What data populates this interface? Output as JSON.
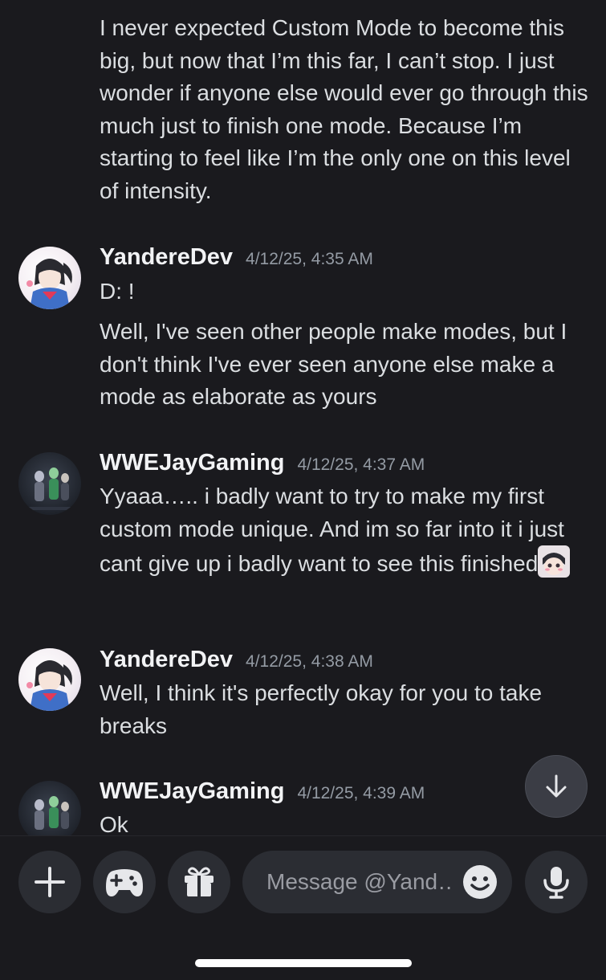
{
  "messages": [
    {
      "continuation_text": "I never expected Custom Mode to become this big, but now that I’m this far, I can’t stop. I just wonder if anyone else would ever go through this much just to finish one mode. Because I’m starting to feel like I’m the only one on this level of intensity."
    },
    {
      "author": "YandereDev",
      "timestamp": "4/12/25, 4:35 AM",
      "lines": [
        "D: !",
        "Well, I've seen other people make modes, but I don't think I've ever seen anyone else make a mode as elaborate as yours"
      ]
    },
    {
      "author": "WWEJayGaming",
      "timestamp": "4/12/25, 4:37 AM",
      "lines": [
        "Yyaaa….. i badly want to try to make my first custom mode unique. And im so far into it i just cant give up i badly want to see this finished"
      ]
    },
    {
      "author": "YandereDev",
      "timestamp": "4/12/25, 4:38 AM",
      "lines": [
        "Well, I think it's perfectly okay for you to take breaks"
      ]
    },
    {
      "author": "WWEJayGaming",
      "timestamp": "4/12/25, 4:39 AM",
      "lines": [
        "Ok"
      ]
    }
  ],
  "composer": {
    "placeholder": "Message @Yand…",
    "icons": [
      "plus-icon",
      "gamepad-icon",
      "gift-icon",
      "smiley-icon",
      "microphone-icon"
    ]
  },
  "jump_button_icon": "arrow-down-icon",
  "colors": {
    "background": "#1a1a1e",
    "text": "#dbdee1",
    "author": "#f2f3f5",
    "timestamp": "#949ba4",
    "button_bg": "#2b2d33"
  }
}
